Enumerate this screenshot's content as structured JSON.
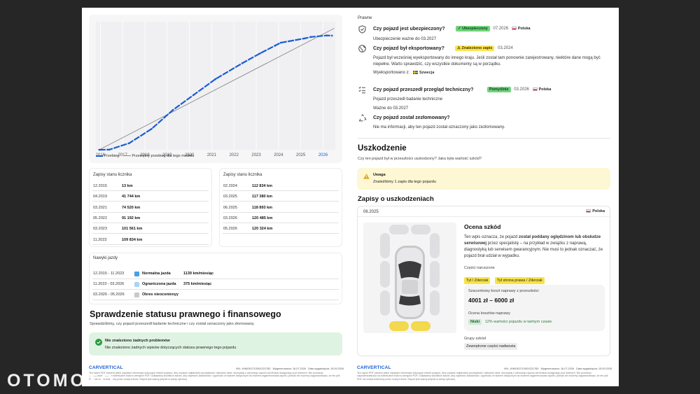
{
  "watermark": "OTOMOTO",
  "chart_data": {
    "type": "line",
    "x_ticks": [
      "2016",
      "2017",
      "2018",
      "2019",
      "2020",
      "2021",
      "2022",
      "2023",
      "2024",
      "2025",
      "2026"
    ],
    "highlight_tick": "2026",
    "series": [
      {
        "name": "Przebieg",
        "style": "dashed-blue",
        "color": "#1a5cd4",
        "points": [
          [
            2015.95,
            0
          ],
          [
            2016.4,
            100
          ],
          [
            2017.3,
            7000
          ],
          [
            2018.3,
            22000
          ],
          [
            2019.25,
            41744
          ],
          [
            2020.2,
            58000
          ],
          [
            2021.17,
            74520
          ],
          [
            2022.37,
            91192
          ],
          [
            2023.17,
            101561
          ],
          [
            2023.85,
            109834
          ],
          [
            2024.1,
            112834
          ],
          [
            2025.17,
            117380
          ],
          [
            2025.45,
            118893
          ],
          [
            2026.17,
            120485
          ],
          [
            2026.4,
            120324
          ]
        ]
      },
      {
        "name": "Przeciętny przebieg dla tego modelu",
        "style": "solid-gray",
        "color": "#8a8a8a",
        "points": [
          [
            2015.95,
            0
          ],
          [
            2026.5,
            128000
          ]
        ]
      }
    ],
    "xlim": [
      2015.8,
      2026.55
    ],
    "ylim": [
      0,
      135000
    ],
    "grid": "vertical",
    "legend_position": "bottom-left"
  },
  "chart_legend": {
    "item1": "Przebieg",
    "item2": "Przeciętny przebieg dla tego modelu"
  },
  "odometer": {
    "title_left": "Zapisy stanu licznika",
    "title_right": "Zapisy stanu licznika",
    "left": [
      {
        "date": "12.2015",
        "km": "13 km"
      },
      {
        "date": "04.2019",
        "km": "41 744 km"
      },
      {
        "date": "03.2021",
        "km": "74 520 km"
      },
      {
        "date": "05.2022",
        "km": "91 192 km"
      },
      {
        "date": "03.2023",
        "km": "101 561 km"
      },
      {
        "date": "11.2023",
        "km": "109 834 km"
      }
    ],
    "right": [
      {
        "date": "02.2024",
        "km": "112 834 km"
      },
      {
        "date": "03.2025",
        "km": "117 380 km"
      },
      {
        "date": "06.2025",
        "km": "118 893 km"
      },
      {
        "date": "03.2026",
        "km": "120 485 km"
      },
      {
        "date": "05.2026",
        "km": "120 324 km"
      }
    ]
  },
  "driving": {
    "title": "Nawyki jazdy",
    "rows": [
      {
        "period": "12.2015 - 11.2023",
        "label": "Normalna jazda",
        "value": "1139 km/miesiąc",
        "color": "#4a9fe8"
      },
      {
        "period": "11.2023 - 03.2026",
        "label": "Ograniczona jazda",
        "value": "375 km/miesiąc",
        "color": "#a9d4f5"
      },
      {
        "period": "03.2026 - 05.2026",
        "label": "Okres nieocenienyy",
        "value": "",
        "color": "#c9c9c9"
      }
    ]
  },
  "legal_status": {
    "title": "Sprawdzenie statusu prawnego i finansowego",
    "subtitle": "Sprawdziliśmy, czy pojazd przeszedł badanie techniczne i czy został oznaczony jako złomowany.",
    "box_title": "Nie znaleziono żadnych problemów",
    "box_text": "Nie znaleziono żadnych wpisów dotyczących statusu prawnego tego pojazdu"
  },
  "footer": {
    "logo": "CARVERTICAL",
    "vin": "VIN: JHMGK371000X221783",
    "generated": "Wygenerowano: 16.07.2026",
    "valid": "Data wygaśnięcia: 15.09.2026",
    "legal": "Ten raport PDF zawiera pełne zapisane informacje dotyczące historii pojazdu. Aby uzyskać najbardziej szczegółowe i aktualne dane, skorzystaj z cyfrowego raportu carVertical dostępnego pod adresem. Nie ponosimy odpowiedzialności za ewentualne braki w wersjach PDF. Dokładamy wszelkich starań, aby zapewnić dokładność i zgodność ze stanem faktycznym na moment wygenerowania raportu, jednak nie możemy zagwarantować, że ten plik PDF nie został zmieniony przez osoby trzecie. Raport jest ważny jedynie w wersji cyfrowej."
  },
  "right": {
    "section_label": "Prawne",
    "insured": {
      "q": "Czy pojazd jest ubezpieczony?",
      "badge": "Ubezpieczony",
      "date": "07.2026",
      "country": "Polska",
      "note": "Ubezpieczenie ważne do 03.2027"
    },
    "export": {
      "q": "Czy pojazd był eksportowany?",
      "badge": "Znaleziono zapis",
      "date": "03.2024",
      "text": "Pojazd był wcześniej wyeksportowany do innego kraju. Jeśli został tam ponownie zarejestrowany, niektóre dane mogą być niepełne. Warto sprawdzić, czy wszystkie dokumenty są w porządku.",
      "exported_label": "Wyeksportowano z:",
      "exported_country": "Szwecja"
    },
    "inspection": {
      "q": "Czy pojazd przeszedł przegląd techniczny?",
      "badge": "Pomyślnie",
      "date": "03.2026",
      "country": "Polska",
      "note1": "Pojazd przeszedł badanie techniczne",
      "note2": "Ważne do 03.2027"
    },
    "scrapped": {
      "q": "Czy pojazd został zezłomowany?",
      "note": "Nie ma informacji, aby ten pojazd został oznaczony jako zezłomowany."
    },
    "damage_title": "Uszkodzenie",
    "damage_sub": "Czy ten pojazd był w przeszłości uszkodzony? Jaka była wartość szkód?",
    "warning_title": "Uwaga",
    "warning_text": "Znaleźliśmy 1 zapis dla tego pojazdu",
    "records_title": "Zapisy o uszkodzeniach",
    "record": {
      "date": "06.2025",
      "country": "Polska",
      "title": "Ocena szkód",
      "desc_pre": "Ten wpis oznacza, że pojazd ",
      "desc_bold": "został poddany oględzinom lub obsłudze serwisowej",
      "desc_post": " przez specjalistę – na przykład w związku z naprawą, diagnostyką lub serwisem gwarancyjnym. Nie musi to jednak oznaczać, że pojazd brał udział w wypadku.",
      "parts_label": "Części naruszone",
      "parts": [
        "Tył / Zderzak",
        "Tył strona prawa / Zderzak"
      ],
      "cost_label": "Szacunkowy koszt naprawy z przeszłości",
      "cost": "4001 zł – 6000 zł",
      "rating_label": "Ocena kosztów naprawy",
      "rating_badge": "Niski",
      "rating_text": "12% wartości pojazdu w tamtym czasie",
      "groups_label": "Grupy szkód",
      "group": "Zewnętrzne części nadwozia"
    }
  }
}
